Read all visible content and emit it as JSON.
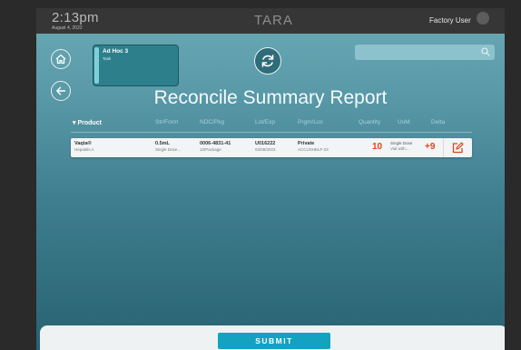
{
  "header": {
    "time": "2:13pm",
    "date": "August 4, 2022",
    "brand": "TARA",
    "user": "Factory User"
  },
  "task": {
    "title": "Ad Hoc 3",
    "subtitle": "Task"
  },
  "search": {
    "placeholder": ""
  },
  "page_title": "Reconcile Summary Report",
  "table": {
    "columns": [
      "Product",
      "Str/Form",
      "NDC/Pkg",
      "Lot/Exp",
      "Prgm/Loc",
      "Quantity",
      "UoM",
      "Delta"
    ],
    "sort_indicator": "▾",
    "rows": [
      {
        "product": "Vaqta®",
        "product_sub": "Hepatitis A",
        "strength": "0.5mL",
        "form": "Single Dose...",
        "ndc": "0006-4831-41",
        "pkg": "10/Package",
        "lot": "U016222",
        "exp": "02/08/2023",
        "program": "Private",
        "location": "ACCUSHELF-23",
        "quantity": "10",
        "uom": "Single Dose",
        "uom_sub": "Vial with...",
        "delta": "+9"
      }
    ]
  },
  "footer": {
    "submit_label": "SUBMIT"
  },
  "colors": {
    "accent": "#13a3c0",
    "alert": "#e0451b",
    "task_card": "#2d7f8c",
    "topbar": "#363636"
  },
  "icons": {
    "home": "home-icon",
    "back": "arrow-left-icon",
    "sync": "refresh-icon",
    "search": "search-icon",
    "edit": "edit-icon"
  }
}
